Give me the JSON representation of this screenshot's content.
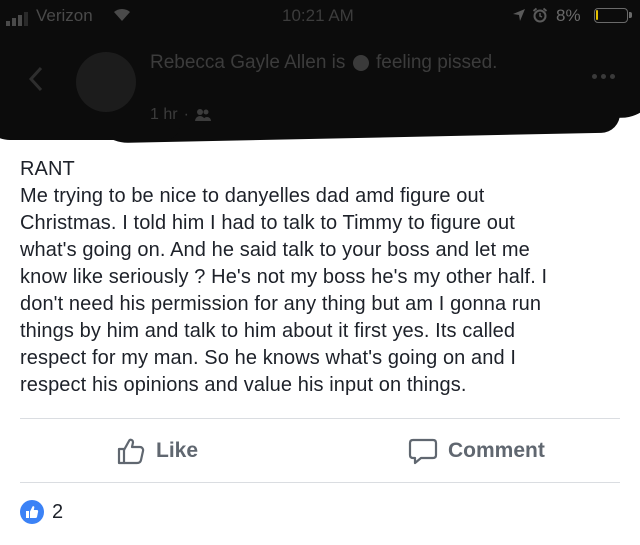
{
  "status_bar": {
    "carrier": "Verizon",
    "time": "10:21 AM",
    "battery_percent": "8%",
    "battery_level": 0.08,
    "battery_color": "#e6c200"
  },
  "post_header": {
    "author": "Rebecca Gayle Allen",
    "feeling_text": "is",
    "feeling_emoji_icon": "feeling-emoji-icon",
    "feeling": "feeling pissed.",
    "timestamp": "1 hr",
    "separator": "·",
    "audience_icon": "friends-icon"
  },
  "post": {
    "text": "RANT\nMe trying to be nice to danyelles dad amd figure out\nChristmas. I told him I had to talk to Timmy to figure out\nwhat's going on. And he said talk to your boss and let me\nknow like seriously ? He's not my boss he's my other half. I\ndon't need his permission for any thing but am I gonna run\nthings by him and talk to him about it first yes. Its called\nrespect for my man. So he knows what's going on and I\nrespect his opinions and value his input on things."
  },
  "actions": {
    "like_label": "Like",
    "comment_label": "Comment"
  },
  "reactions": {
    "count": "2",
    "color": "#3b82f6"
  }
}
